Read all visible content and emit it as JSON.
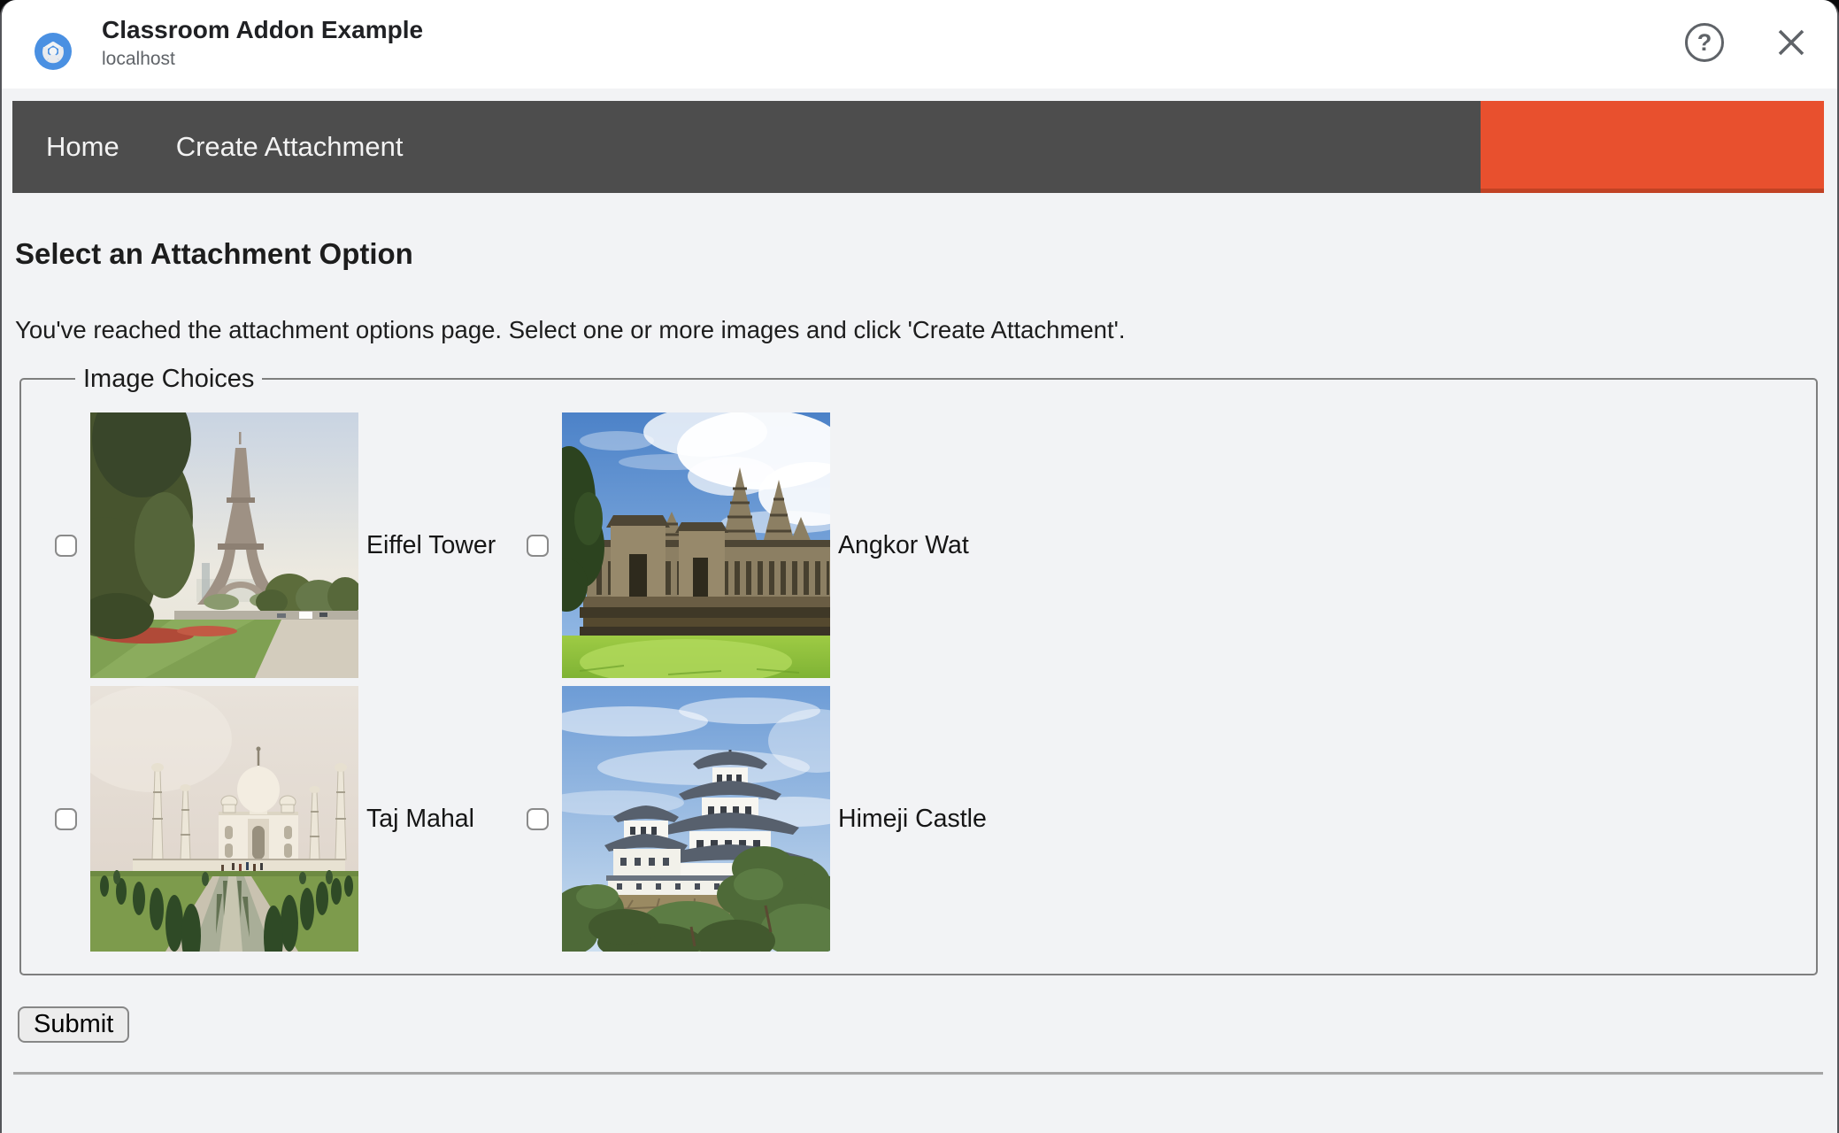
{
  "window": {
    "title": "Classroom Addon Example",
    "subtitle": "localhost",
    "help_glyph": "?"
  },
  "nav": {
    "items": [
      {
        "label": "Home"
      },
      {
        "label": "Create Attachment"
      }
    ]
  },
  "content": {
    "heading": "Select an Attachment Option",
    "description": "You've reached the attachment options page. Select one or more images and click 'Create Attachment'.",
    "image_choices": {
      "legend": "Image Choices",
      "options": [
        {
          "label": "Eiffel Tower",
          "checked": false
        },
        {
          "label": "Angkor Wat",
          "checked": false
        },
        {
          "label": "Taj Mahal",
          "checked": false
        },
        {
          "label": "Himeji Castle",
          "checked": false
        }
      ]
    },
    "submit_label": "Submit"
  },
  "colors": {
    "nav_bg": "#4d4d4d",
    "nav_accent": "#e8502e",
    "page_bg": "#f2f3f5",
    "header_bg": "#ffffff",
    "icon_gray": "#5f6368"
  }
}
